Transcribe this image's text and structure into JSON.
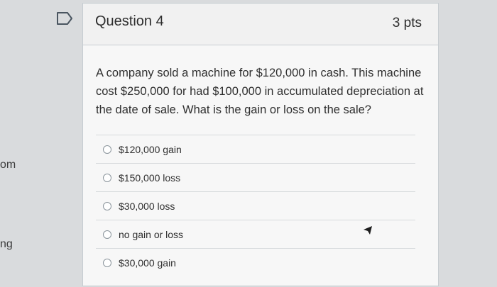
{
  "sidebar": {
    "fragments": [
      "om",
      "ng"
    ]
  },
  "question": {
    "title": "Question 4",
    "points": "3 pts",
    "text": "A company sold a machine for $120,000 in cash. This machine cost $250,000 for had $100,000 in accumulated depreciation at the date of sale. What is the gain or loss on the sale?",
    "answers": [
      {
        "label": "$120,000 gain",
        "selected": false
      },
      {
        "label": "$150,000 loss",
        "selected": false
      },
      {
        "label": "$30,000 loss",
        "selected": false
      },
      {
        "label": "no gain or loss",
        "selected": false
      },
      {
        "label": "$30,000 gain",
        "selected": false
      }
    ]
  },
  "icons": {
    "flag": "bookmark-flag-icon",
    "cursor": "mouse-pointer-icon"
  }
}
